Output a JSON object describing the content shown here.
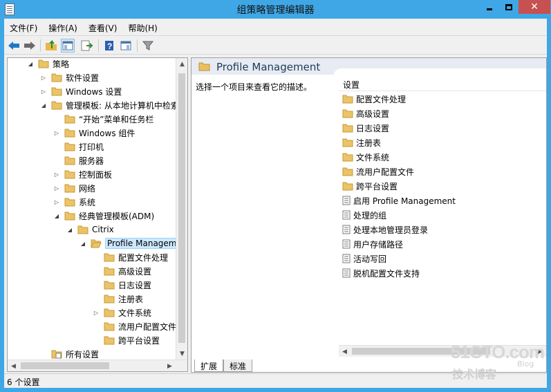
{
  "window": {
    "title": "组策略管理编辑器",
    "close_glyph": "✕"
  },
  "menubar": [
    "文件(F)",
    "操作(A)",
    "查看(V)",
    "帮助(H)"
  ],
  "toolbar": [
    {
      "name": "back-arrow-icon",
      "color": "#1e78c8"
    },
    {
      "name": "forward-arrow-icon",
      "color": "#6a6a6a"
    },
    {
      "name": "up-folder-icon",
      "color": "#e8b84a"
    },
    {
      "name": "show-hide-tree-icon",
      "color": "#4a78a8"
    },
    {
      "name": "export-list-icon",
      "color": "#3a8a3a"
    },
    {
      "name": "help-icon",
      "color": "#2a5fb0"
    },
    {
      "name": "properties-view-icon",
      "color": "#4a78a8"
    },
    {
      "name": "filter-icon",
      "color": "#707070"
    }
  ],
  "tree": [
    {
      "label": "策略",
      "state": "open",
      "icon": "folder"
    },
    {
      "label": "软件设置",
      "state": "closed",
      "icon": "folder"
    },
    {
      "label": "Windows 设置",
      "state": "closed",
      "icon": "folder"
    },
    {
      "label": "管理模板: 从本地计算机中检索",
      "state": "open",
      "icon": "folder"
    },
    {
      "label": "“开始”菜单和任务栏",
      "state": "none",
      "icon": "folder"
    },
    {
      "label": "Windows 组件",
      "state": "closed",
      "icon": "folder"
    },
    {
      "label": "打印机",
      "state": "none",
      "icon": "folder"
    },
    {
      "label": "服务器",
      "state": "none",
      "icon": "folder"
    },
    {
      "label": "控制面板",
      "state": "closed",
      "icon": "folder"
    },
    {
      "label": "网络",
      "state": "closed",
      "icon": "folder"
    },
    {
      "label": "系统",
      "state": "closed",
      "icon": "folder"
    },
    {
      "label": "经典管理模板(ADM)",
      "state": "open",
      "icon": "folder"
    },
    {
      "label": "Citrix",
      "state": "open",
      "icon": "folder"
    },
    {
      "label": "Profile Manageme",
      "state": "open",
      "icon": "folder-open",
      "selected": true
    },
    {
      "label": "配置文件处理",
      "state": "none",
      "icon": "folder"
    },
    {
      "label": "高级设置",
      "state": "none",
      "icon": "folder"
    },
    {
      "label": "日志设置",
      "state": "none",
      "icon": "folder"
    },
    {
      "label": "注册表",
      "state": "none",
      "icon": "folder"
    },
    {
      "label": "文件系统",
      "state": "closed",
      "icon": "folder"
    },
    {
      "label": "流用户配置文件",
      "state": "none",
      "icon": "folder"
    },
    {
      "label": "跨平台设置",
      "state": "none",
      "icon": "folder"
    },
    {
      "label": "所有设置",
      "state": "none",
      "icon": "all-settings"
    }
  ],
  "right": {
    "title": "Profile Management",
    "description": "选择一个项目来查看它的描述。",
    "column_header": "设置",
    "items": [
      {
        "label": "配置文件处理",
        "icon": "folder"
      },
      {
        "label": "高级设置",
        "icon": "folder"
      },
      {
        "label": "日志设置",
        "icon": "folder"
      },
      {
        "label": "注册表",
        "icon": "folder"
      },
      {
        "label": "文件系统",
        "icon": "folder"
      },
      {
        "label": "流用户配置文件",
        "icon": "folder"
      },
      {
        "label": "跨平台设置",
        "icon": "folder"
      },
      {
        "label": "启用 Profile Management",
        "icon": "setting"
      },
      {
        "label": "处理的组",
        "icon": "setting"
      },
      {
        "label": "处理本地管理员登录",
        "icon": "setting"
      },
      {
        "label": "用户存储路径",
        "icon": "setting"
      },
      {
        "label": "活动写回",
        "icon": "setting"
      },
      {
        "label": "脱机配置文件支持",
        "icon": "setting"
      }
    ],
    "tabs": [
      "扩展",
      "标准"
    ]
  },
  "status": "6 个设置",
  "watermark": {
    "logo": "51CTO.com",
    "sub": "技术博客",
    "blog": "Blog"
  }
}
